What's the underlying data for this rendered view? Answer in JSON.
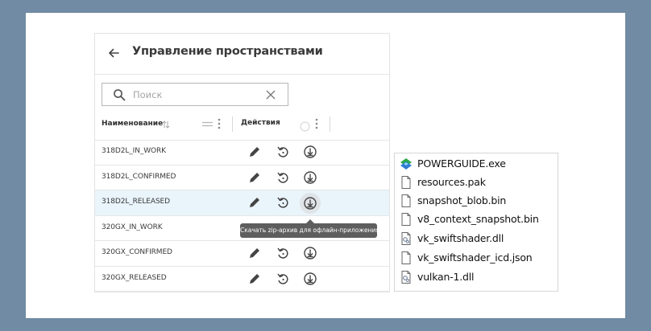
{
  "header": {
    "title": "Управление пространствами"
  },
  "search": {
    "placeholder": "Поиск",
    "value": ""
  },
  "columns": {
    "name": "Наименование",
    "actions": "Действия"
  },
  "rows": [
    {
      "name": "318D2L_IN_WORK",
      "selected": false
    },
    {
      "name": "318D2L_CONFIRMED",
      "selected": false
    },
    {
      "name": "318D2L_RELEASED",
      "selected": true
    },
    {
      "name": "320GX_IN_WORK",
      "selected": false
    },
    {
      "name": "320GX_CONFIRMED",
      "selected": false
    },
    {
      "name": "320GX_RELEASED",
      "selected": false
    }
  ],
  "tooltip": {
    "text": "Скачать zip-архив для офлайн-приложения"
  },
  "files": [
    {
      "name": "POWERGUIDE.exe",
      "icon": "app-logo-icon"
    },
    {
      "name": "resources.pak",
      "icon": "file-icon"
    },
    {
      "name": "snapshot_blob.bin",
      "icon": "file-icon"
    },
    {
      "name": "v8_context_snapshot.bin",
      "icon": "file-icon"
    },
    {
      "name": "vk_swiftshader.dll",
      "icon": "dll-file-icon"
    },
    {
      "name": "vk_swiftshader_icd.json",
      "icon": "file-icon"
    },
    {
      "name": "vulkan-1.dll",
      "icon": "dll-file-icon"
    }
  ],
  "colors": {
    "background": "#708ba3",
    "selected_row": "#e9f4fb",
    "tooltip_bg": "#5e5e5e",
    "icon": "#444444",
    "app_logo_green": "#2eaa4a",
    "app_logo_blue": "#1f6fd1"
  }
}
